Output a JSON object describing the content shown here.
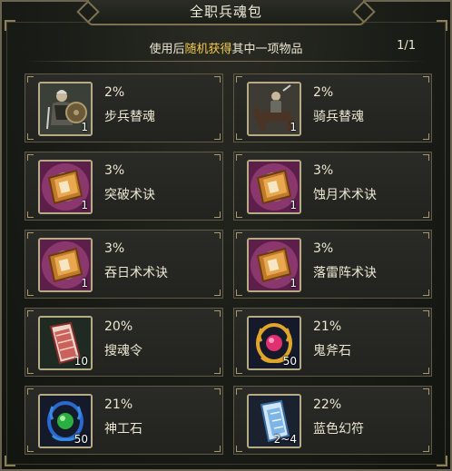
{
  "title": "全职兵魂包",
  "subtitle": {
    "pre": "使用后",
    "highlight": "随机获得",
    "post": "其中一项物品"
  },
  "page": "1/1",
  "items": [
    {
      "pct": "2%",
      "name": "步兵替魂",
      "qty": "1",
      "icon": "infantry-soldier-icon"
    },
    {
      "pct": "2%",
      "name": "骑兵替魂",
      "qty": "1",
      "icon": "cavalry-rider-icon"
    },
    {
      "pct": "3%",
      "name": "突破术诀",
      "qty": "1",
      "icon": "skill-book-icon"
    },
    {
      "pct": "3%",
      "name": "蚀月术术诀",
      "qty": "1",
      "icon": "skill-book-icon"
    },
    {
      "pct": "3%",
      "name": "吞日术术诀",
      "qty": "1",
      "icon": "skill-book-icon"
    },
    {
      "pct": "3%",
      "name": "落雷阵术诀",
      "qty": "1",
      "icon": "skill-book-icon"
    },
    {
      "pct": "20%",
      "name": "搜魂令",
      "qty": "10",
      "icon": "soul-scroll-icon"
    },
    {
      "pct": "21%",
      "name": "鬼斧石",
      "qty": "50",
      "icon": "red-gem-amulet-icon"
    },
    {
      "pct": "21%",
      "name": "神工石",
      "qty": "50",
      "icon": "green-gem-amulet-icon"
    },
    {
      "pct": "22%",
      "name": "蓝色幻符",
      "qty": "2~4",
      "icon": "blue-talisman-icon"
    }
  ],
  "colors": {
    "accent": "#f2c94c",
    "text": "#ece6d2",
    "border": "#5f5946"
  }
}
